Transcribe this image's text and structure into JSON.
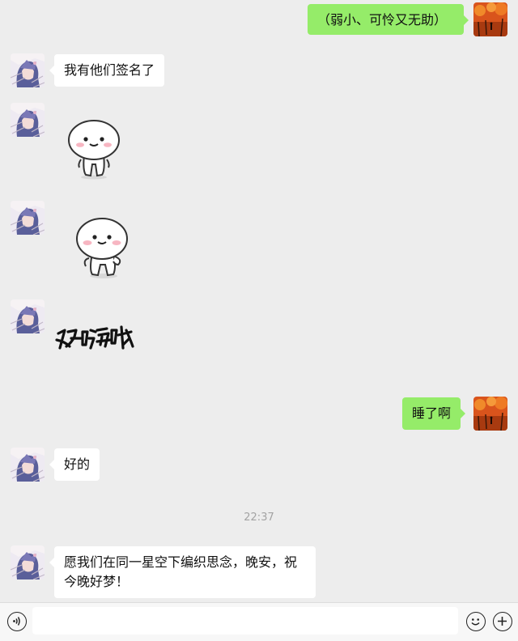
{
  "messages": [
    {
      "side": "out",
      "type": "text",
      "text": "（弱小、可怜又无助）"
    },
    {
      "side": "in",
      "type": "text",
      "text": "我有他们签名了"
    },
    {
      "side": "in",
      "type": "sticker",
      "sticker": "bun-character-standing"
    },
    {
      "side": "in",
      "type": "sticker",
      "sticker": "bun-character-hand-on-hip"
    },
    {
      "side": "in",
      "type": "sticker",
      "sticker": "handwritten-text-sticker",
      "text": "好嗨哦"
    },
    {
      "side": "out",
      "type": "text",
      "text": "睡了啊"
    },
    {
      "side": "in",
      "type": "text",
      "text": "好的"
    },
    {
      "side": "in",
      "type": "text",
      "text": "愿我们在同一星空下编织思念，晚安，祝今晚好梦！"
    }
  ],
  "timestamp": "22:37",
  "input_bar": {
    "placeholder": "",
    "voice_icon": "voice-icon",
    "emoji_icon": "emoji-icon",
    "plus_icon": "plus-icon"
  },
  "colors": {
    "background": "#ededed",
    "incoming_bubble": "#ffffff",
    "outgoing_bubble": "#95ec69",
    "timestamp": "#a3a3a3"
  }
}
